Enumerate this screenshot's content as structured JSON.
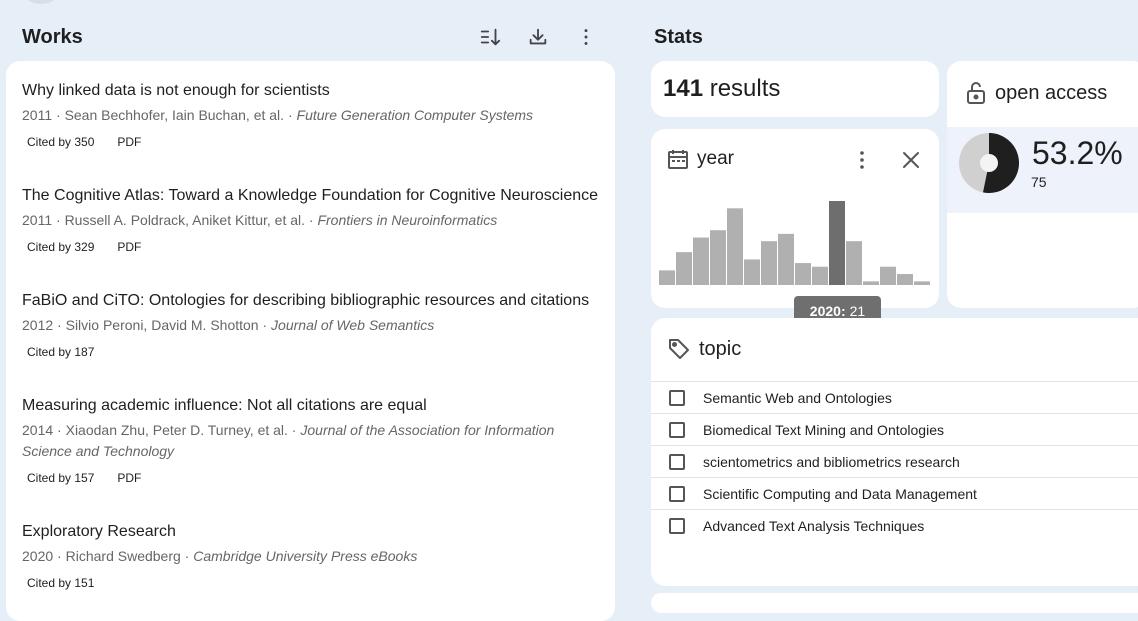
{
  "works": {
    "title": "Works",
    "items": [
      {
        "title": "Why linked data is not enough for scientists",
        "year": "2011",
        "authors": "Sean Bechhofer, Iain Buchan, et al.",
        "venue": "Future Generation Computer Systems",
        "cited": "Cited by 350",
        "pdf": "PDF"
      },
      {
        "title": "The Cognitive Atlas: Toward a Knowledge Foundation for Cognitive Neuroscience",
        "year": "2011",
        "authors": "Russell A. Poldrack, Aniket Kittur, et al.",
        "venue": "Frontiers in Neuroinformatics",
        "cited": "Cited by 329",
        "pdf": "PDF"
      },
      {
        "title": "FaBiO and CiTO: Ontologies for describing bibliographic resources and citations",
        "year": "2012",
        "authors": "Silvio Peroni, David M. Shotton",
        "venue": "Journal of Web Semantics",
        "cited": "Cited by 187",
        "pdf": ""
      },
      {
        "title": "Measuring academic influence: Not all citations are equal",
        "year": "2014",
        "authors": "Xiaodan Zhu, Peter D. Turney, et al.",
        "venue": "Journal of the Association for Information Science and Technology",
        "cited": "Cited by 157",
        "pdf": "PDF"
      },
      {
        "title": "Exploratory Research",
        "year": "2020",
        "authors": "Richard Swedberg",
        "venue": "Cambridge University Press eBooks",
        "cited": "Cited by 151",
        "pdf": ""
      }
    ],
    "separator": " · "
  },
  "toolbar": {
    "sort_icon": "sort-icon",
    "download_icon": "download-icon",
    "more_icon": "more-vert-icon"
  },
  "stats": {
    "title": "Stats",
    "results_count": "141",
    "results_label": " results"
  },
  "open_access": {
    "title": "open access",
    "percent": "53.2%",
    "count": "75",
    "fraction": 0.532,
    "colors": {
      "oa": "#1f1f1f",
      "closed": "#d0d0d0"
    }
  },
  "year_filter": {
    "title": "year",
    "tooltip_year": "2020:",
    "tooltip_count": "21",
    "bar_values": [
      4,
      9,
      13,
      15,
      21,
      7,
      12,
      14,
      6,
      5,
      23,
      12,
      1,
      5,
      3,
      1
    ],
    "highlight_index": 10,
    "colors": {
      "bar": "#b0b0b0",
      "highlight": "#6e6e6e"
    }
  },
  "topic": {
    "title": "topic",
    "items": [
      "Semantic Web and Ontologies",
      "Biomedical Text Mining and Ontologies",
      "scientometrics and bibliometrics research",
      "Scientific Computing and Data Management",
      "Advanced Text Analysis Techniques"
    ]
  }
}
